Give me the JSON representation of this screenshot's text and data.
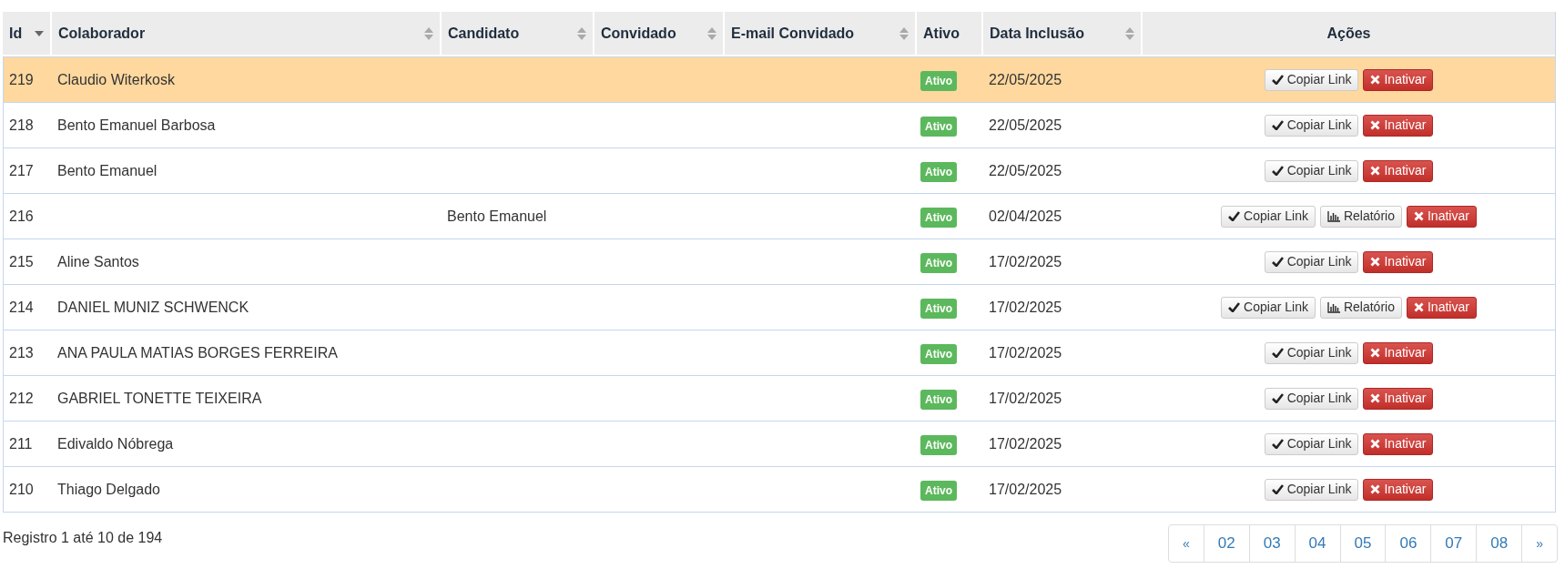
{
  "table": {
    "columns": [
      {
        "label": "Id",
        "sortable": true,
        "sorted": true
      },
      {
        "label": "Colaborador",
        "sortable": true,
        "sorted": false
      },
      {
        "label": "Candidato",
        "sortable": true,
        "sorted": false
      },
      {
        "label": "Convidado",
        "sortable": true,
        "sorted": false
      },
      {
        "label": "E-mail Convidado",
        "sortable": true,
        "sorted": false
      },
      {
        "label": "Ativo",
        "sortable": false,
        "sorted": false
      },
      {
        "label": "Data Inclusão",
        "sortable": true,
        "sorted": false
      },
      {
        "label": "Ações",
        "sortable": false,
        "sorted": false
      }
    ],
    "rows": [
      {
        "selected": true,
        "id": "219",
        "colaborador": "Claudio Witerkosk",
        "candidato": "",
        "status": "Ativo",
        "date": "22/05/2025",
        "actions": [
          {
            "kind": "copy",
            "label": "Copiar Link"
          },
          {
            "kind": "deactivate",
            "label": "Inativar"
          }
        ]
      },
      {
        "selected": false,
        "id": "218",
        "colaborador": "Bento Emanuel Barbosa",
        "candidato": "",
        "status": "Ativo",
        "date": "22/05/2025",
        "actions": [
          {
            "kind": "copy",
            "label": "Copiar Link"
          },
          {
            "kind": "deactivate",
            "label": "Inativar"
          }
        ]
      },
      {
        "selected": false,
        "id": "217",
        "colaborador": "Bento Emanuel",
        "candidato": "",
        "status": "Ativo",
        "date": "22/05/2025",
        "actions": [
          {
            "kind": "copy",
            "label": "Copiar Link"
          },
          {
            "kind": "deactivate",
            "label": "Inativar"
          }
        ]
      },
      {
        "selected": false,
        "id": "216",
        "colaborador": "",
        "candidato": "Bento Emanuel",
        "status": "Ativo",
        "date": "02/04/2025",
        "actions": [
          {
            "kind": "copy",
            "label": "Copiar Link"
          },
          {
            "kind": "report",
            "label": "Relatório"
          },
          {
            "kind": "deactivate",
            "label": "Inativar"
          }
        ]
      },
      {
        "selected": false,
        "id": "215",
        "colaborador": "Aline Santos",
        "candidato": "",
        "status": "Ativo",
        "date": "17/02/2025",
        "actions": [
          {
            "kind": "copy",
            "label": "Copiar Link"
          },
          {
            "kind": "deactivate",
            "label": "Inativar"
          }
        ]
      },
      {
        "selected": false,
        "id": "214",
        "colaborador": "DANIEL MUNIZ SCHWENCK",
        "candidato": "",
        "status": "Ativo",
        "date": "17/02/2025",
        "actions": [
          {
            "kind": "copy",
            "label": "Copiar Link"
          },
          {
            "kind": "report",
            "label": "Relatório"
          },
          {
            "kind": "deactivate",
            "label": "Inativar"
          }
        ]
      },
      {
        "selected": false,
        "id": "213",
        "colaborador": "ANA PAULA MATIAS BORGES FERREIRA",
        "candidato": "",
        "status": "Ativo",
        "date": "17/02/2025",
        "actions": [
          {
            "kind": "copy",
            "label": "Copiar Link"
          },
          {
            "kind": "deactivate",
            "label": "Inativar"
          }
        ]
      },
      {
        "selected": false,
        "id": "212",
        "colaborador": "GABRIEL TONETTE TEIXEIRA",
        "candidato": "",
        "status": "Ativo",
        "date": "17/02/2025",
        "actions": [
          {
            "kind": "copy",
            "label": "Copiar Link"
          },
          {
            "kind": "deactivate",
            "label": "Inativar"
          }
        ]
      },
      {
        "selected": false,
        "id": "211",
        "colaborador": "Edivaldo Nóbrega",
        "candidato": "",
        "status": "Ativo",
        "date": "17/02/2025",
        "actions": [
          {
            "kind": "copy",
            "label": "Copiar Link"
          },
          {
            "kind": "deactivate",
            "label": "Inativar"
          }
        ]
      },
      {
        "selected": false,
        "id": "210",
        "colaborador": "Thiago Delgado",
        "candidato": "",
        "status": "Ativo",
        "date": "17/02/2025",
        "actions": [
          {
            "kind": "copy",
            "label": "Copiar Link"
          },
          {
            "kind": "deactivate",
            "label": "Inativar"
          }
        ]
      }
    ]
  },
  "footer": {
    "summary": "Registro 1 até 10 de 194"
  },
  "pagination": [
    "«",
    "02",
    "03",
    "04",
    "05",
    "06",
    "07",
    "08",
    "»"
  ]
}
